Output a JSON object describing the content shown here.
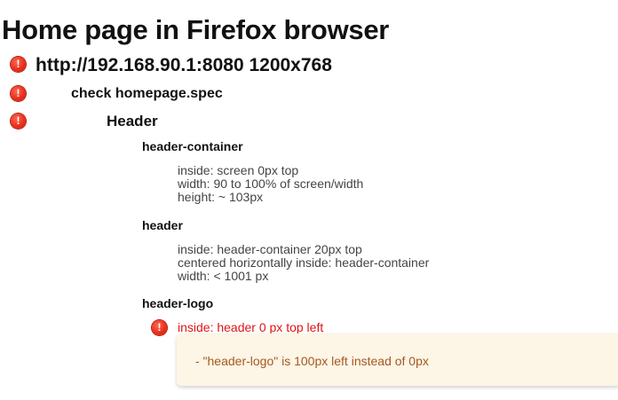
{
  "report": {
    "title": "Home page in Firefox browser",
    "test": {
      "status": "error",
      "label": "http://192.168.90.1:8080 1200x768"
    },
    "spec_file": {
      "status": "error",
      "label": "check homepage.spec"
    },
    "section": {
      "status": "error",
      "label": "Header"
    },
    "objects": [
      {
        "name": "header-container",
        "specs": [
          "inside: screen 0px top",
          "width: 90 to 100% of screen/width",
          "height: ~ 103px"
        ]
      },
      {
        "name": "header",
        "specs": [
          "inside: header-container 20px top",
          "centered horizontally inside: header-container",
          "width: < 1001 px"
        ]
      },
      {
        "name": "header-logo",
        "failed_spec": {
          "status": "error",
          "text": "inside: header 0 px top left",
          "error_message": "-   \"header-logo\" is 100px left instead of 0px"
        }
      }
    ]
  },
  "colors": {
    "error_icon": "#e8301c",
    "failed_text": "#e01414",
    "error_box_bg": "#fdf5e6",
    "error_box_text": "#a35a1f"
  },
  "icons": {
    "status_error": "error-icon"
  }
}
